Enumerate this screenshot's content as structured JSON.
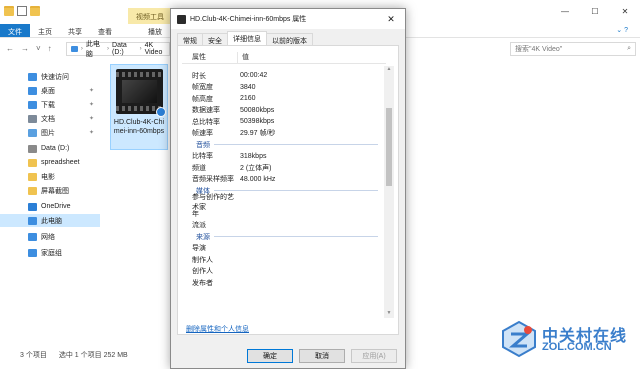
{
  "explorer": {
    "context_tab": "视频工具",
    "ribbon_tabs": [
      "文件",
      "主页",
      "共享",
      "查看",
      "播放"
    ],
    "help_icon": "help-icon",
    "breadcrumb": [
      "此电脑",
      "Data (D:)",
      "4K Video"
    ],
    "search_placeholder": "搜索\"4K Video\"",
    "nav_items": [
      {
        "label": "快速访问",
        "icon": "star-icon",
        "color": "#3d8ee0"
      },
      {
        "label": "桌面",
        "icon": "desktop-icon",
        "color": "#3d8ee0",
        "pinned": true
      },
      {
        "label": "下载",
        "icon": "download-icon",
        "color": "#3d8ee0",
        "pinned": true
      },
      {
        "label": "文档",
        "icon": "documents-icon",
        "color": "#7d8a99",
        "pinned": true
      },
      {
        "label": "图片",
        "icon": "pictures-icon",
        "color": "#5aa0e0",
        "pinned": true
      },
      {
        "label": "Data (D:)",
        "icon": "drive-icon",
        "color": "#8a8a8a"
      },
      {
        "label": "spreadsheet",
        "icon": "folder-icon",
        "color": "#f0c350"
      },
      {
        "label": "电影",
        "icon": "folder-icon",
        "color": "#f0c350"
      },
      {
        "label": "屏幕截图",
        "icon": "folder-icon",
        "color": "#f0c350"
      },
      {
        "label": "OneDrive",
        "icon": "onedrive-icon",
        "color": "#2b7fd6"
      },
      {
        "label": "此电脑",
        "icon": "pc-icon",
        "color": "#3d8ee0",
        "selected": true
      },
      {
        "label": "网络",
        "icon": "network-icon",
        "color": "#3d8ee0"
      },
      {
        "label": "家庭组",
        "icon": "homegroup-icon",
        "color": "#3d8ee0"
      }
    ],
    "file_name": "HD.Club-4K-Chimei-inn-60mbps",
    "status": [
      "3 个项目",
      "选中 1 个项目  252 MB"
    ]
  },
  "dialog": {
    "title": "HD.Club-4K-Chimei-inn-60mbps 属性",
    "tabs": [
      "常规",
      "安全",
      "详细信息",
      "以前的版本"
    ],
    "active_tab": 2,
    "col_property": "属性",
    "col_value": "值",
    "rows": [
      {
        "k": "时长",
        "v": "00:00:42"
      },
      {
        "k": "帧宽度",
        "v": "3840"
      },
      {
        "k": "帧高度",
        "v": "2160"
      },
      {
        "k": "数据速率",
        "v": "50080kbps"
      },
      {
        "k": "总比特率",
        "v": "50398kbps"
      },
      {
        "k": "帧速率",
        "v": "29.97 帧/秒"
      },
      {
        "group": "音频"
      },
      {
        "k": "比特率",
        "v": "318kbps"
      },
      {
        "k": "频道",
        "v": "2 (立体声)"
      },
      {
        "k": "音频采样频率",
        "v": "48.000 kHz"
      },
      {
        "group": "媒体"
      },
      {
        "k": "参与创作的艺术家",
        "v": ""
      },
      {
        "k": "年",
        "v": ""
      },
      {
        "k": "流派",
        "v": ""
      },
      {
        "group": "来源"
      },
      {
        "k": "导演",
        "v": ""
      },
      {
        "k": "制作人",
        "v": ""
      },
      {
        "k": "创作人",
        "v": ""
      },
      {
        "k": "发布者",
        "v": ""
      }
    ],
    "remove_link": "删除属性和个人信息",
    "ok": "确定",
    "cancel": "取消",
    "apply": "应用(A)"
  },
  "watermark": {
    "text": "中关村在线",
    "sub": "ZOL.COM.CN"
  }
}
